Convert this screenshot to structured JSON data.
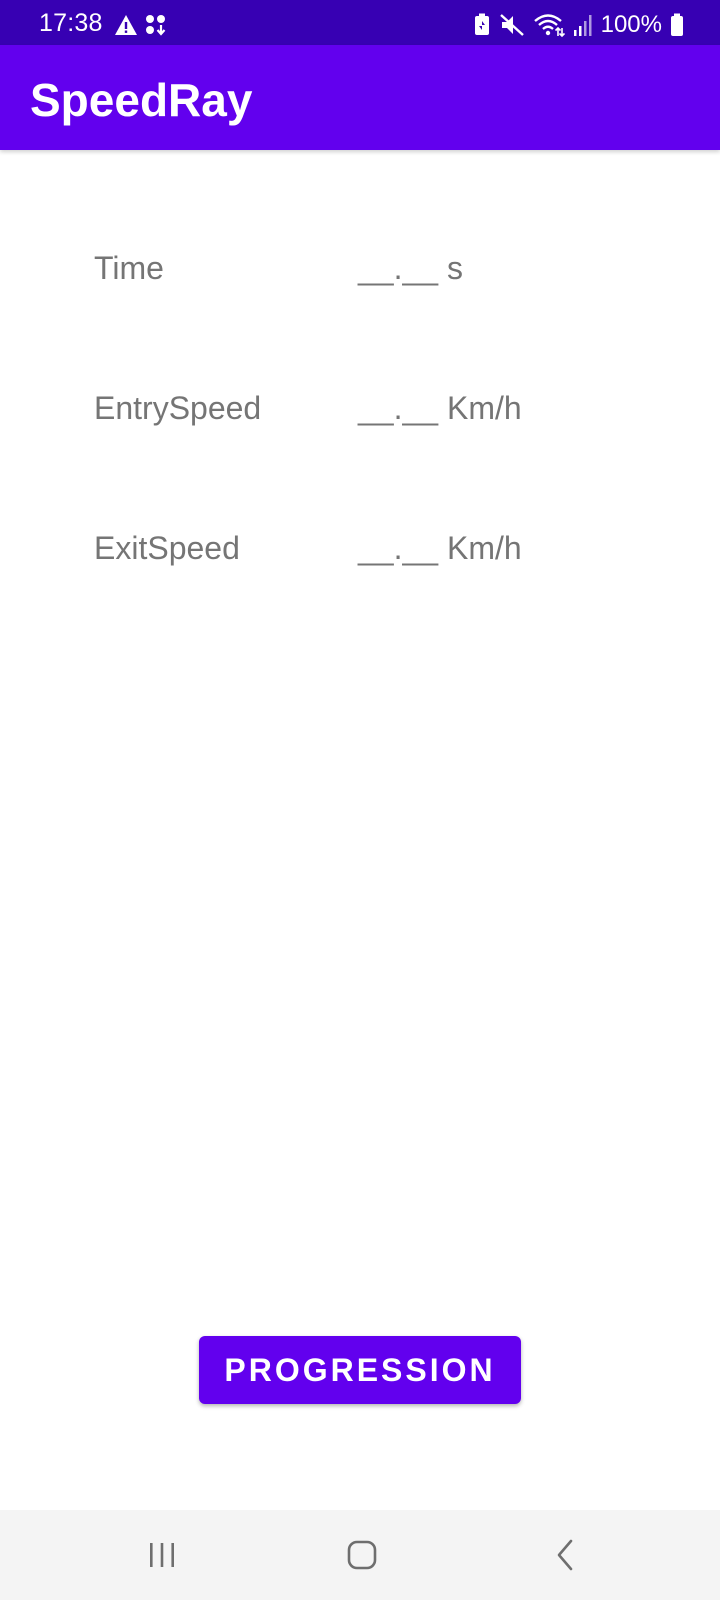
{
  "status_bar": {
    "time": "17:38",
    "left_icons": [
      "warning-icon",
      "download-icon"
    ],
    "right_icons": [
      "battery-saver-icon",
      "mute-icon",
      "wifi-icon",
      "signal-icon",
      "battery-icon"
    ],
    "battery_percent": "100%",
    "background": "#3700b3"
  },
  "app_bar": {
    "title": "SpeedRay",
    "background": "#6200ee"
  },
  "readouts": [
    {
      "label": "Time",
      "value": "__.__ s"
    },
    {
      "label": "EntrySpeed",
      "value": "__.__ Km/h"
    },
    {
      "label": "ExitSpeed",
      "value": "__.__ Km/h"
    }
  ],
  "progress_button": {
    "label": "PROGRESSION",
    "background": "#6200ee"
  },
  "nav_bar": {
    "buttons": [
      "recent-apps-icon",
      "home-icon",
      "back-icon"
    ],
    "background": "#f4f4f4"
  }
}
